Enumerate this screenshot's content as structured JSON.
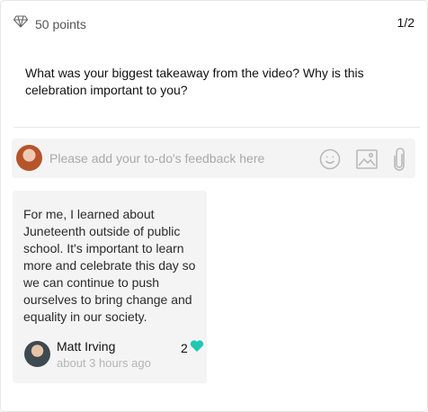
{
  "header": {
    "points_label": "50 points",
    "page_indicator": "1/2"
  },
  "question": {
    "text": "What was your biggest takeaway from the video? Why is this celebration important to you?"
  },
  "feedback": {
    "placeholder": "Please add your to-do's feedback here",
    "tools": [
      "emoji-icon",
      "image-icon",
      "attachment-icon"
    ]
  },
  "comment": {
    "text": "For me, I learned about Juneteenth outside of public school. It's important to learn more and celebrate this day so we can continue to push ourselves to  bring change and equality in our society.",
    "author": "Matt Irving",
    "time": "about 3 hours ago",
    "like_count": "2",
    "like_color": "#1fc8b4"
  }
}
